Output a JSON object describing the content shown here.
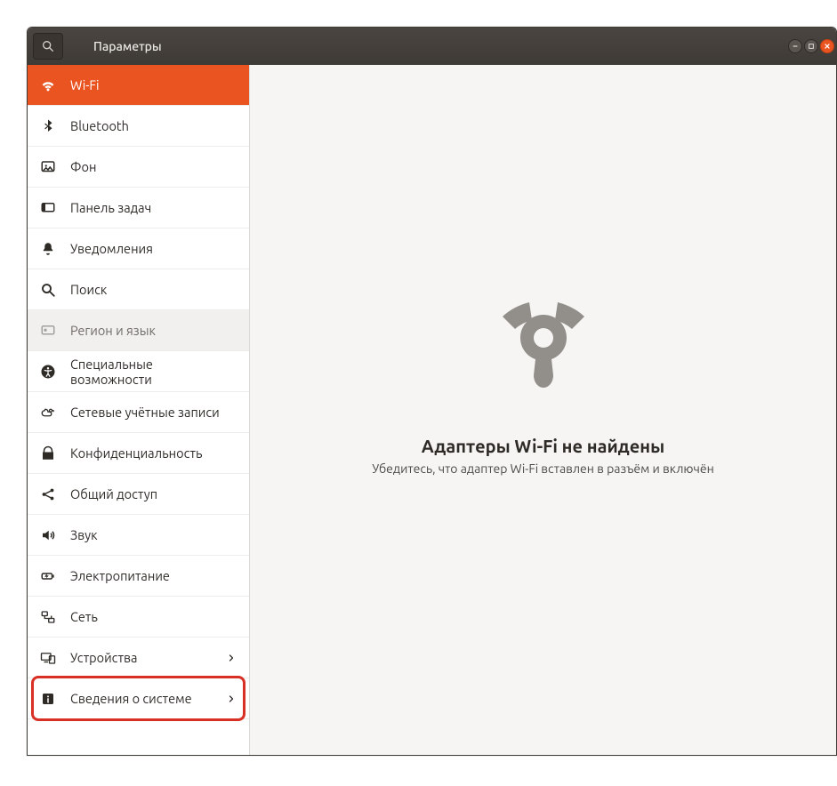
{
  "window": {
    "title": "Параметры"
  },
  "sidebar": {
    "items": [
      {
        "label": "Wi-Fi"
      },
      {
        "label": "Bluetooth"
      },
      {
        "label": "Фон"
      },
      {
        "label": "Панель задач"
      },
      {
        "label": "Уведомления"
      },
      {
        "label": "Поиск"
      },
      {
        "label": "Регион и язык"
      },
      {
        "label": "Специальные возможности"
      },
      {
        "label": "Сетевые учётные записи"
      },
      {
        "label": "Конфиденциальность"
      },
      {
        "label": "Общий доступ"
      },
      {
        "label": "Звук"
      },
      {
        "label": "Электропитание"
      },
      {
        "label": "Сеть"
      },
      {
        "label": "Устройства"
      },
      {
        "label": "Сведения о системе"
      }
    ]
  },
  "content": {
    "title": "Адаптеры Wi-Fi не найдены",
    "subtitle": "Убедитесь, что адаптер Wi-Fi вставлен в разъём и включён"
  }
}
